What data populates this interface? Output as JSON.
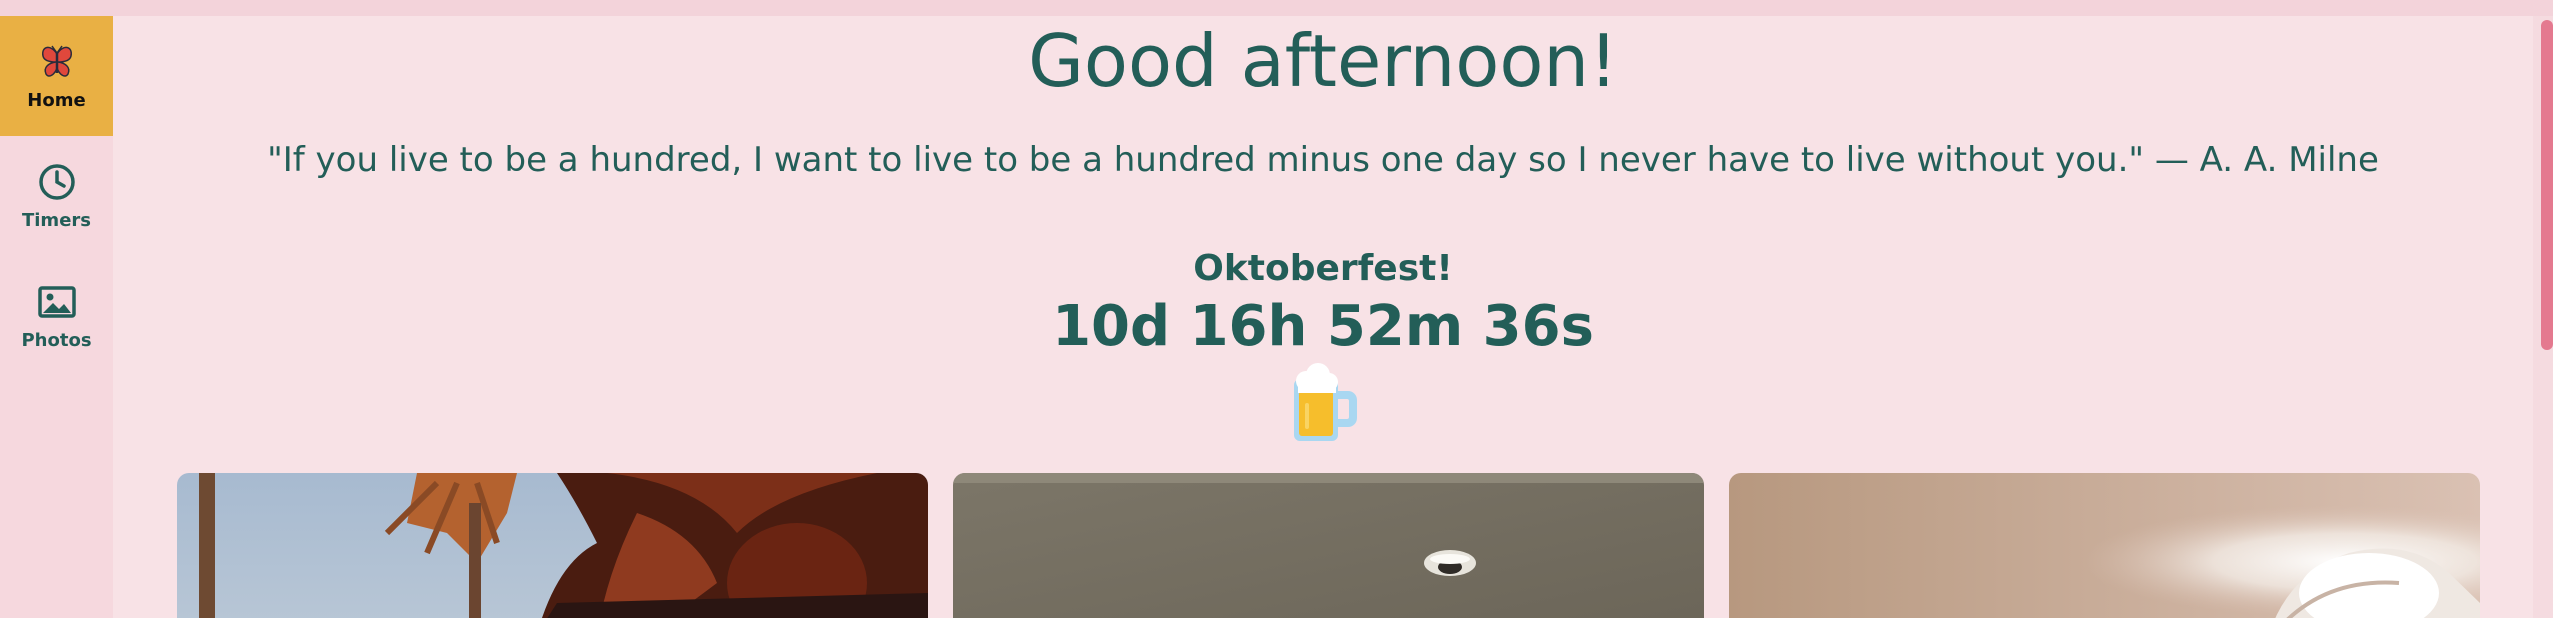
{
  "sidebar": {
    "items": [
      {
        "label": "Home",
        "icon": "butterfly-icon",
        "active": true
      },
      {
        "label": "Timers",
        "icon": "clock-icon",
        "active": false
      },
      {
        "label": "Photos",
        "icon": "image-icon",
        "active": false
      }
    ]
  },
  "main": {
    "greeting": "Good afternoon!",
    "quote": "\"If you live to be a hundred, I want to live to be a hundred minus one day so I never have to live without you.\" — A. A. Milne",
    "timer": {
      "title": "Oktoberfest!",
      "countdown": "10d 16h 52m 36s",
      "emoji_icon": "beer-mug-icon"
    },
    "photos": [
      {
        "icon": "photo-beach-person"
      },
      {
        "icon": "photo-ceiling"
      },
      {
        "icon": "photo-ceiling-light"
      }
    ]
  },
  "colors": {
    "background": "#f8e2e6",
    "sidebar": "#f6d8de",
    "active_nav": "#e9b044",
    "text": "#235e58",
    "scrollbar": "#e4798f"
  }
}
